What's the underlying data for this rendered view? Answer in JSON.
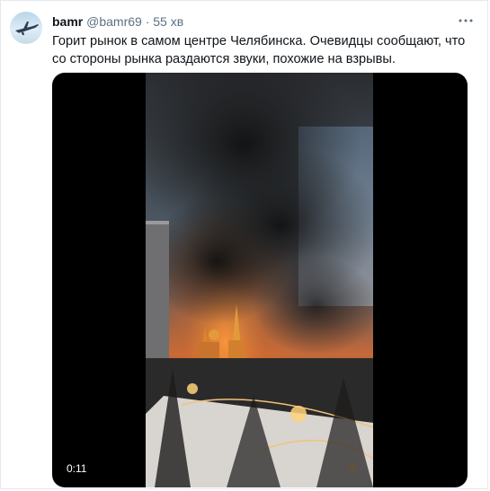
{
  "tweet": {
    "display_name": "bamr",
    "handle": "@bamr69",
    "separator": "·",
    "time": "55 хв",
    "text": "Горит рынок в самом центре Челябинска. Очевидцы сообщают, что со стороны рынка раздаются звуки, похожие на взрывы."
  },
  "video": {
    "timestamp": "0:11"
  },
  "icons": {
    "avatar": "avatar-airplane",
    "more": "more-icon"
  },
  "colors": {
    "text": "#0f1419",
    "secondary": "#5b7083",
    "border": "#e6e9ec",
    "media_bg": "#000000"
  }
}
